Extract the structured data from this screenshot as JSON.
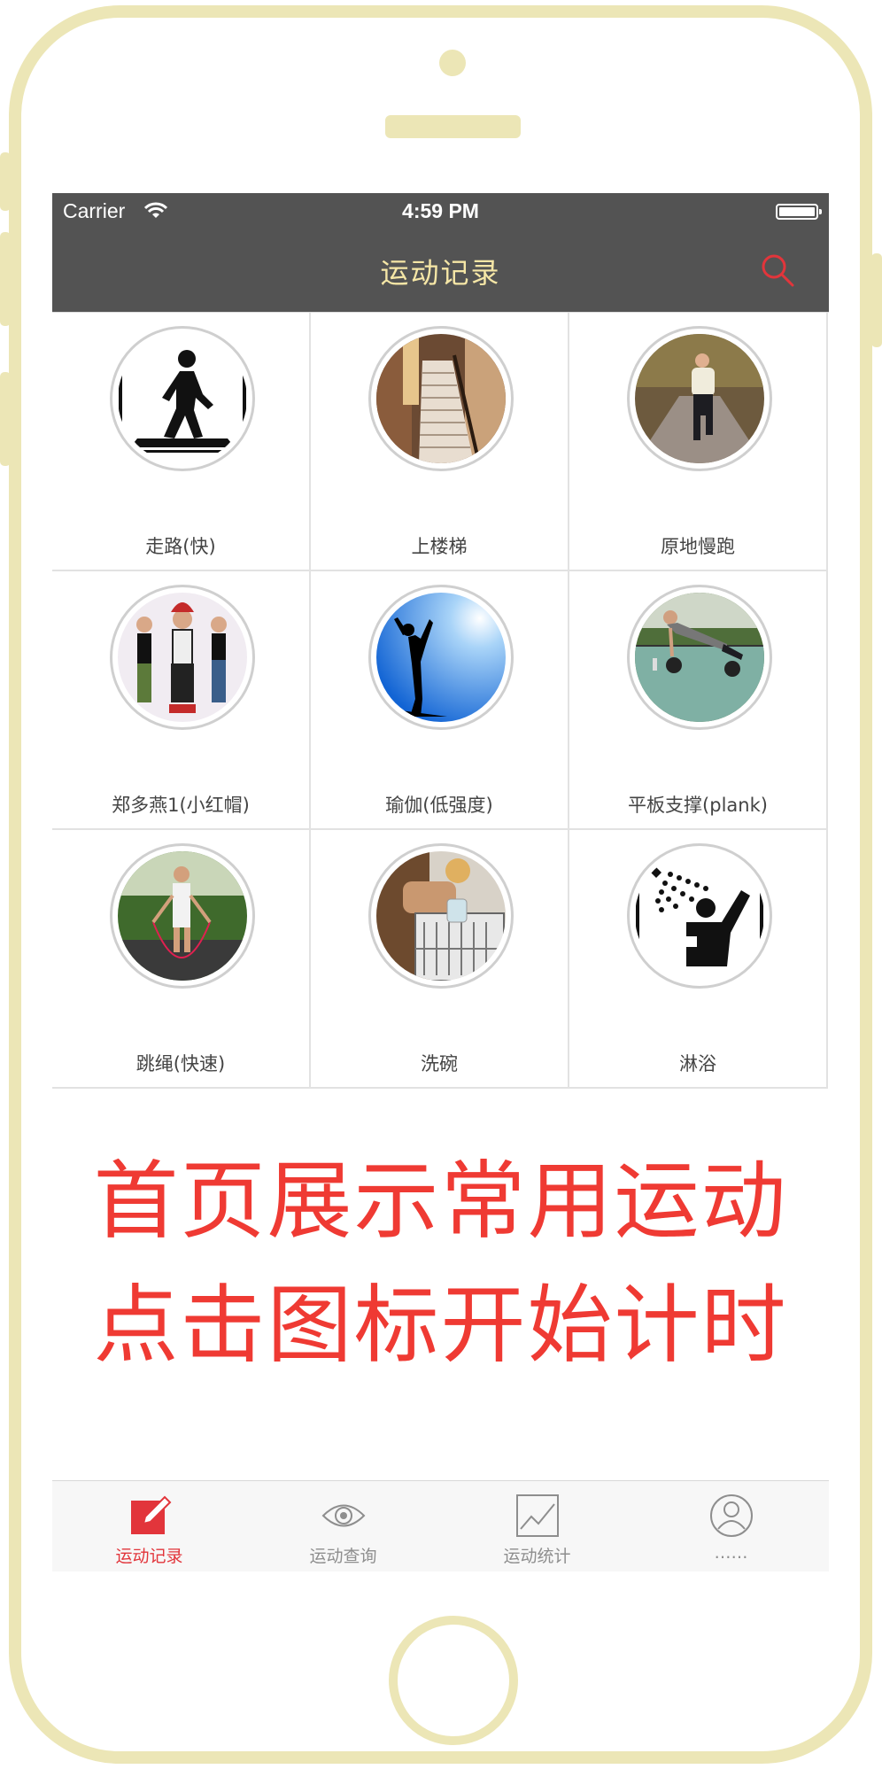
{
  "status_bar": {
    "carrier": "Carrier",
    "time": "4:59 PM",
    "wifi_icon": "wifi-icon",
    "battery_icon": "battery-icon"
  },
  "nav": {
    "title": "运动记录",
    "search_icon": "search-icon",
    "title_color": "#f5e6a6",
    "accent_color": "#e2353b"
  },
  "activities": [
    {
      "label": "走路(快)",
      "icon": "walking-icon"
    },
    {
      "label": "上楼梯",
      "icon": "stairs-photo"
    },
    {
      "label": "原地慢跑",
      "icon": "jogging-photo"
    },
    {
      "label": "郑多燕1(小红帽)",
      "icon": "aerobics-photo"
    },
    {
      "label": "瑜伽(低强度)",
      "icon": "yoga-photo"
    },
    {
      "label": "平板支撑(plank)",
      "icon": "plank-photo"
    },
    {
      "label": "跳绳(快速)",
      "icon": "jump-rope-photo"
    },
    {
      "label": "洗碗",
      "icon": "dishwashing-photo"
    },
    {
      "label": "淋浴",
      "icon": "shower-icon"
    }
  ],
  "promo": {
    "line1": "首页展示常用运动",
    "line2": "点击图标开始计时",
    "color": "#ef3a33"
  },
  "tabs": [
    {
      "label": "运动记录",
      "icon": "edit-icon",
      "active": true
    },
    {
      "label": "运动查询",
      "icon": "eye-icon",
      "active": false
    },
    {
      "label": "运动统计",
      "icon": "chart-icon",
      "active": false
    },
    {
      "label": "……",
      "icon": "user-icon",
      "active": false
    }
  ]
}
